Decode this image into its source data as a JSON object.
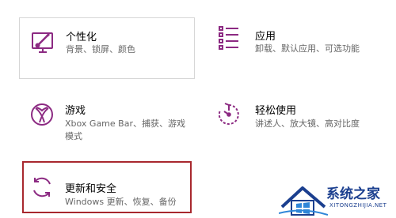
{
  "tiles": {
    "personalization": {
      "title": "个性化",
      "desc": "背景、锁屏、颜色",
      "icon": "personalization-brush-icon"
    },
    "apps": {
      "title": "应用",
      "desc": "卸载、默认应用、可选功能",
      "icon": "apps-list-icon"
    },
    "gaming": {
      "title": "游戏",
      "desc": "Xbox Game Bar、捕获、游戏模式",
      "icon": "xbox-icon"
    },
    "ease": {
      "title": "轻松使用",
      "desc": "讲述人、放大镜、高对比度",
      "icon": "ease-of-access-timer-icon"
    },
    "update": {
      "title": "更新和安全",
      "desc": "Windows 更新、恢复、备份",
      "icon": "sync-refresh-icon"
    }
  },
  "watermark": {
    "name": "系统之家",
    "url": "XITONGZHIJIA.NET"
  },
  "colors": {
    "icon_accent": "#8c2a82",
    "highlight_border": "#a8282e",
    "watermark_blue": "#1b3f8f"
  }
}
